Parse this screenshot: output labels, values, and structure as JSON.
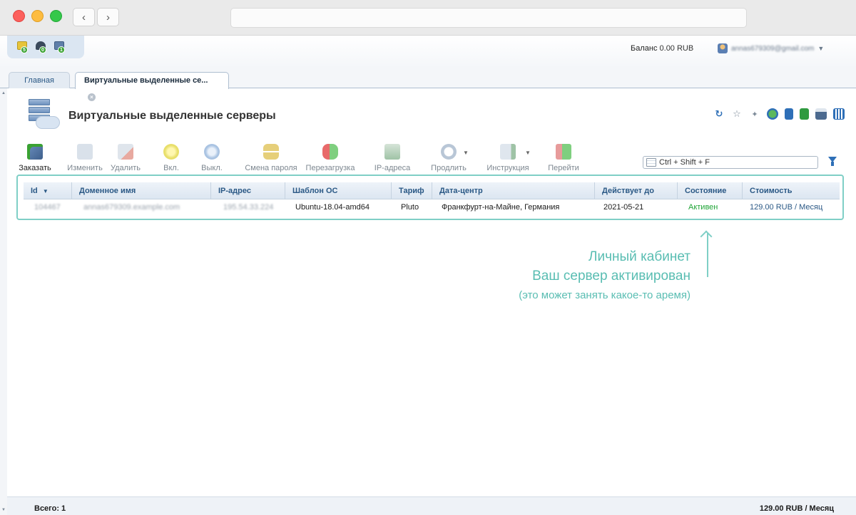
{
  "appbar": {
    "notifications": [
      {
        "icon": "envelope-icon",
        "count": "5",
        "color": "#e7c43a"
      },
      {
        "icon": "headset-icon",
        "count": "0",
        "color": "#3b4a5c"
      },
      {
        "icon": "monitor-icon",
        "count": "1",
        "color": "#5f7fa9"
      }
    ],
    "balance_label": "Баланс",
    "balance_value": "0.00 RUB",
    "user_email": "annas679309@gmail.com"
  },
  "tabs": [
    {
      "label": "Главная"
    },
    {
      "label": "Виртуальные выделенные се..."
    }
  ],
  "page": {
    "title": "Виртуальные выделенные серверы",
    "header_actions": [
      {
        "icon": "refresh-icon"
      },
      {
        "icon": "star-icon"
      },
      {
        "icon": "pin-icon"
      },
      {
        "icon": "globe-icon"
      },
      {
        "icon": "document-icon"
      },
      {
        "icon": "excel-export-icon"
      },
      {
        "icon": "print-icon"
      },
      {
        "icon": "columns-settings-icon"
      }
    ]
  },
  "toolbar": {
    "order": "Заказать",
    "edit": "Изменить",
    "delete": "Удалить",
    "on": "Вкл.",
    "off": "Выкл.",
    "change_password": "Смена пароля",
    "reboot": "Перезагрузка",
    "ip_addresses": "IP-адреса",
    "renew": "Продлить",
    "instruction": "Инструкция",
    "go": "Перейти"
  },
  "search": {
    "placeholder": "Ctrl + Shift + F"
  },
  "table": {
    "columns": [
      "Id",
      "Доменное имя",
      "IP-адрес",
      "Шаблон ОС",
      "Тариф",
      "Дата-центр",
      "Действует до",
      "Состояние",
      "Стоимость"
    ],
    "rows": [
      {
        "id": "104467",
        "domain": "annas679309.example.com",
        "ip": "195.54.33.224",
        "os": "Ubuntu-18.04-amd64",
        "tariff": "Pluto",
        "datacenter": "Франкфурт-на-Майне, Германия",
        "valid_until": "2021-05-21",
        "status": "Активен",
        "price": "129.00 RUB",
        "period": "Месяц"
      }
    ]
  },
  "annotation": {
    "line1": "Личный кабинет",
    "line2": "Ваш сервер активирован",
    "line3": "(это может занять какое-то аремя)",
    "color": "#59bdb2"
  },
  "footer": {
    "total": "Всего: 1",
    "sum": "129.00 RUB / Месяц"
  }
}
